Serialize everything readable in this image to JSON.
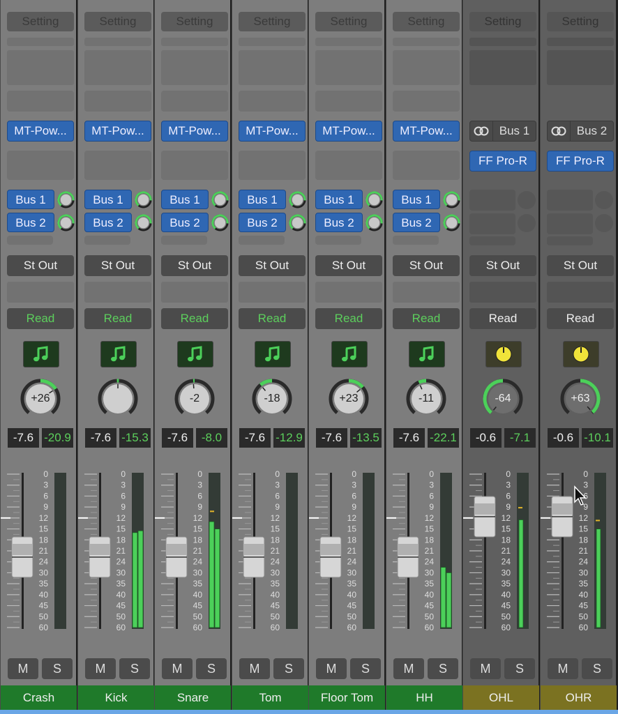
{
  "colors": {
    "plugin_blue": "#2f67b3",
    "green_track": "#1f7a2a",
    "aux_track": "#7b7221",
    "meter_green": "#4cd05a",
    "peak_text": "#5ccf5c"
  },
  "meter_scale": [
    "0",
    "3",
    "6",
    "9",
    "12",
    "15",
    "18",
    "21",
    "24",
    "30",
    "35",
    "40",
    "45",
    "50",
    "60"
  ],
  "channels": [
    {
      "name": "Crash",
      "type": "audio",
      "setting": "Setting",
      "plugin": "MT-Pow...",
      "sends": [
        "Bus 1",
        "Bus 2"
      ],
      "output": "St Out",
      "automation": "Read",
      "icon": "music-note-icon",
      "pan": "+26",
      "pan_value": 26,
      "volume": "-7.6",
      "peak": "-20.9",
      "fader_db": -7.6,
      "meter_l": null,
      "meter_r": null,
      "mute": "M",
      "solo": "S"
    },
    {
      "name": "Kick",
      "type": "audio",
      "setting": "Setting",
      "plugin": "MT-Pow...",
      "sends": [
        "Bus 1",
        "Bus 2"
      ],
      "output": "St Out",
      "automation": "Read",
      "icon": "music-note-icon",
      "pan": "",
      "pan_value": 0,
      "volume": "-7.6",
      "peak": "-15.3",
      "fader_db": -7.6,
      "meter_l": -16,
      "meter_r": -15.5,
      "mute": "M",
      "solo": "S"
    },
    {
      "name": "Snare",
      "type": "audio",
      "setting": "Setting",
      "plugin": "MT-Pow...",
      "sends": [
        "Bus 1",
        "Bus 2"
      ],
      "output": "St Out",
      "automation": "Read",
      "icon": "music-note-icon",
      "pan": "-2",
      "pan_value": -2,
      "volume": "-7.6",
      "peak": "-8.0",
      "fader_db": -7.6,
      "meter_l": -13,
      "meter_r": -15,
      "peak_hold": -10,
      "mute": "M",
      "solo": "S"
    },
    {
      "name": "Tom",
      "type": "audio",
      "setting": "Setting",
      "plugin": "MT-Pow...",
      "sends": [
        "Bus 1",
        "Bus 2"
      ],
      "output": "St Out",
      "automation": "Read",
      "icon": "music-note-icon",
      "pan": "-18",
      "pan_value": -18,
      "volume": "-7.6",
      "peak": "-12.9",
      "fader_db": -7.6,
      "meter_l": null,
      "meter_r": null,
      "mute": "M",
      "solo": "S"
    },
    {
      "name": "Floor Tom",
      "type": "audio",
      "setting": "Setting",
      "plugin": "MT-Pow...",
      "sends": [
        "Bus 1",
        "Bus 2"
      ],
      "output": "St Out",
      "automation": "Read",
      "icon": "music-note-icon",
      "pan": "+23",
      "pan_value": 23,
      "volume": "-7.6",
      "peak": "-13.5",
      "fader_db": -7.6,
      "meter_l": null,
      "meter_r": null,
      "mute": "M",
      "solo": "S"
    },
    {
      "name": "HH",
      "type": "audio",
      "setting": "Setting",
      "plugin": "MT-Pow...",
      "sends": [
        "Bus 1",
        "Bus 2"
      ],
      "output": "St Out",
      "automation": "Read",
      "icon": "music-note-icon",
      "pan": "-11",
      "pan_value": -11,
      "volume": "-7.6",
      "peak": "-22.1",
      "fader_db": -7.6,
      "meter_l": -27,
      "meter_r": -30,
      "mute": "M",
      "solo": "S"
    },
    {
      "name": "OHL",
      "type": "aux",
      "setting": "Setting",
      "input": "Bus 1",
      "plugin": "FF Pro-R",
      "output": "St Out",
      "automation": "Read",
      "icon": "knob-icon",
      "pan": "-64",
      "pan_value": -64,
      "volume": "-0.6",
      "peak": "-7.1",
      "fader_db": -0.6,
      "meter_l": -12.5,
      "meter_r": null,
      "peak_hold": -9,
      "mute": "M",
      "solo": "S"
    },
    {
      "name": "OHR",
      "type": "aux",
      "setting": "Setting",
      "input": "Bus 2",
      "plugin": "FF Pro-R",
      "output": "St Out",
      "automation": "Read",
      "icon": "knob-icon",
      "pan": "+63",
      "pan_value": 63,
      "volume": "-0.6",
      "peak": "-10.1",
      "fader_db": -0.6,
      "meter_l": -15,
      "meter_r": null,
      "peak_hold": -12.5,
      "mute": "M",
      "solo": "S"
    }
  ]
}
